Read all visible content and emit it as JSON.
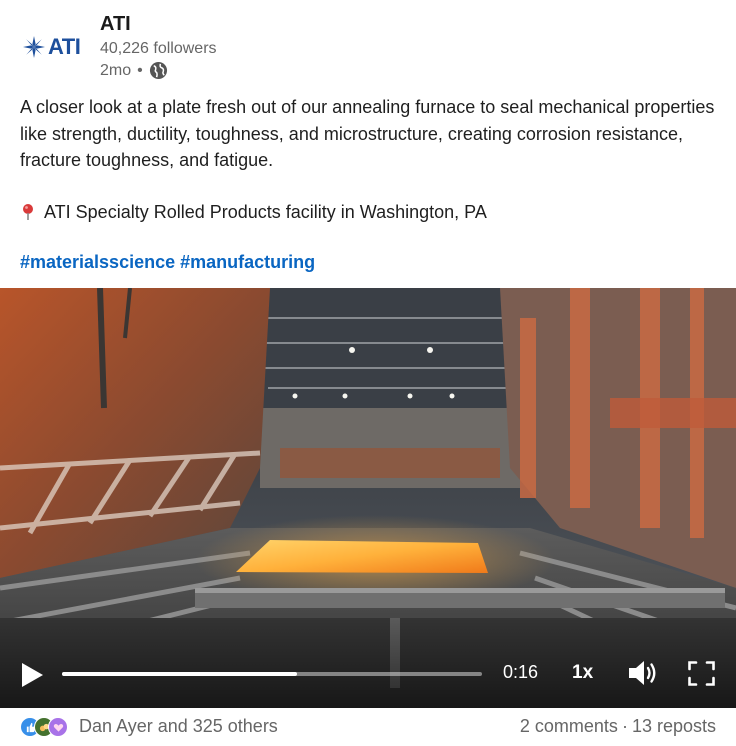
{
  "author": {
    "logo_text": "ATI",
    "name": "ATI",
    "followers": "40,226 followers",
    "posted_ago": "2mo",
    "separator": "•",
    "visibility_icon": "globe-icon"
  },
  "post": {
    "body": "A closer look at a plate fresh out of our annealing furnace to seal mechanical properties like strength, ductility, toughness, and microstructure, creating corrosion resistance, fracture toughness, and fatigue.",
    "location_icon": "map-pin-icon",
    "location": "ATI Specialty Rolled Products facility in Washington, PA",
    "hashtags": [
      "#materialsscience",
      "#manufacturing"
    ]
  },
  "video": {
    "progress": 0.56,
    "time": "0:16",
    "speed": "1x",
    "icons": [
      "play-icon",
      "volume-icon",
      "fullscreen-icon"
    ]
  },
  "social": {
    "reaction_icons": [
      "like-icon",
      "celebrate-icon",
      "support-icon"
    ],
    "reactors": "Dan Ayer and 325 others",
    "comments": "2 comments",
    "separator": "·",
    "reposts": "13 reposts"
  },
  "colors": {
    "link": "#0a66c2",
    "brand": "#1d4f9c",
    "muted": "#666666"
  }
}
